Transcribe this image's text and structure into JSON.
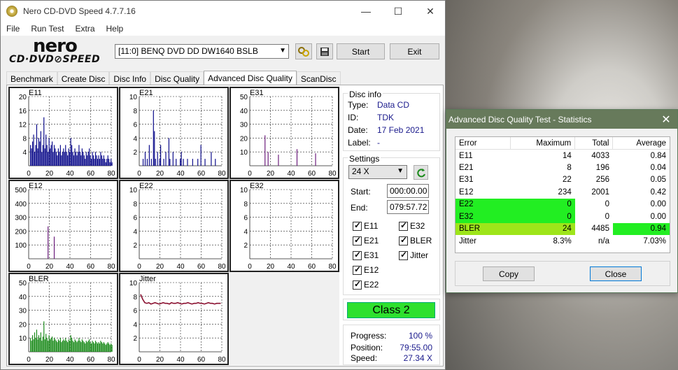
{
  "window": {
    "title": "Nero CD-DVD Speed 4.7.7.16",
    "minimize": "—",
    "maximize": "☐",
    "close": "✕"
  },
  "menu": [
    "File",
    "Run Test",
    "Extra",
    "Help"
  ],
  "logo": {
    "top": "nero",
    "bottom": "CD·DVD⊘SPEED"
  },
  "toolbar": {
    "drive": "[11:0]   BENQ DVD DD DW1640 BSLB",
    "start": "Start",
    "exit": "Exit"
  },
  "tabs": [
    "Benchmark",
    "Create Disc",
    "Disc Info",
    "Disc Quality",
    "Advanced Disc Quality",
    "ScanDisc"
  ],
  "active_tab": "Advanced Disc Quality",
  "disc_info": {
    "title": "Disc info",
    "type_label": "Type:",
    "type": "Data CD",
    "id_label": "ID:",
    "id": "TDK",
    "date_label": "Date:",
    "date": "17 Feb 2021",
    "label_label": "Label:",
    "label": "-"
  },
  "settings": {
    "title": "Settings",
    "speed": "24 X",
    "start_label": "Start:",
    "start": "000:00.00",
    "end_label": "End:",
    "end": "079:57.72",
    "checks": [
      "E11",
      "E32",
      "E21",
      "BLER",
      "E31",
      "Jitter",
      "E12",
      "E22"
    ]
  },
  "class_label": "Class 2",
  "progress": {
    "progress_label": "Progress:",
    "progress": "100 %",
    "position_label": "Position:",
    "position": "79:55.00",
    "speed_label": "Speed:",
    "speed": "27.34 X"
  },
  "colors": {
    "graph_blue": "#0a0a8a",
    "graph_purple": "#6a1a7a",
    "graph_green": "#1a8a1a",
    "jitter_red": "#8a1030",
    "class_green": "#2ee02e"
  },
  "chart_data": [
    {
      "type": "bar",
      "title": "E11",
      "x": [
        0,
        20,
        40,
        60,
        80
      ],
      "ylim": [
        0,
        20
      ],
      "yticks": [
        4,
        8,
        12,
        16,
        20
      ],
      "xticks": [
        0,
        20,
        40,
        60,
        80
      ],
      "series": [
        {
          "values": [
            6,
            5,
            7,
            9,
            4,
            6,
            12,
            5,
            8,
            7,
            10,
            4,
            6,
            14,
            5,
            9,
            6,
            4,
            8,
            5,
            6,
            7,
            4,
            6,
            5,
            4,
            3,
            5,
            4,
            6,
            3,
            4,
            5,
            4,
            6,
            4,
            3,
            5,
            4,
            8,
            6,
            4,
            3,
            5,
            4,
            3,
            4,
            6,
            4,
            3,
            5,
            4,
            3,
            2,
            4,
            3,
            4,
            5,
            3,
            2,
            4,
            3,
            2,
            4,
            3,
            2,
            3,
            2,
            4,
            3,
            2,
            3,
            2,
            1,
            2,
            3,
            2,
            1,
            2,
            1
          ]
        }
      ]
    },
    {
      "type": "bar",
      "title": "E21",
      "x": [
        0,
        20,
        40,
        60,
        80
      ],
      "ylim": [
        0,
        10
      ],
      "yticks": [
        2,
        4,
        6,
        8,
        10
      ],
      "xticks": [
        0,
        20,
        40,
        60,
        80
      ],
      "series": [
        {
          "values": [
            0,
            0,
            1,
            0,
            2,
            0,
            1,
            0,
            3,
            0,
            1,
            0,
            8,
            5,
            1,
            0,
            2,
            0,
            1,
            3,
            0,
            0,
            1,
            0,
            2,
            0,
            0,
            4,
            1,
            0,
            0,
            2,
            0,
            0,
            1,
            0,
            0,
            0,
            1,
            2,
            0,
            1,
            0,
            0,
            0,
            1,
            0,
            0,
            0,
            0,
            1,
            0,
            0,
            0,
            0,
            1,
            0,
            0,
            3,
            0,
            0,
            0,
            1,
            0,
            0,
            0,
            0,
            0,
            2,
            0,
            0,
            0,
            1,
            0,
            0,
            0,
            0,
            0,
            0,
            0
          ]
        }
      ]
    },
    {
      "type": "bar",
      "title": "E31",
      "x": [
        0,
        20,
        40,
        60,
        80
      ],
      "ylim": [
        0,
        50
      ],
      "yticks": [
        10,
        20,
        30,
        40,
        50
      ],
      "xticks": [
        0,
        20,
        40,
        60,
        80
      ],
      "series": [
        {
          "values": [
            0,
            0,
            0,
            0,
            0,
            0,
            0,
            0,
            0,
            0,
            0,
            0,
            0,
            22,
            0,
            0,
            10,
            0,
            0,
            0,
            0,
            0,
            0,
            0,
            0,
            0,
            8,
            0,
            0,
            0,
            0,
            0,
            0,
            0,
            0,
            0,
            0,
            0,
            0,
            0,
            0,
            0,
            0,
            0,
            12,
            0,
            0,
            0,
            0,
            0,
            0,
            0,
            0,
            0,
            0,
            0,
            0,
            0,
            0,
            0,
            0,
            0,
            9,
            0,
            0,
            0,
            0,
            0,
            0,
            0,
            0,
            0,
            0,
            0,
            0,
            0,
            0,
            0,
            0,
            0
          ]
        }
      ]
    },
    {
      "type": "bar",
      "title": "E12",
      "x": [
        0,
        20,
        40,
        60,
        80
      ],
      "ylim": [
        0,
        500
      ],
      "yticks": [
        100,
        200,
        300,
        400,
        500
      ],
      "xticks": [
        0,
        20,
        40,
        60,
        80
      ],
      "series": [
        {
          "values": [
            0,
            0,
            0,
            0,
            0,
            0,
            0,
            0,
            0,
            0,
            0,
            0,
            0,
            0,
            0,
            0,
            0,
            234,
            0,
            0,
            0,
            0,
            0,
            160,
            0,
            0,
            0,
            0,
            0,
            0,
            0,
            0,
            0,
            0,
            0,
            0,
            0,
            0,
            0,
            0,
            0,
            0,
            0,
            0,
            0,
            0,
            0,
            0,
            0,
            0,
            0,
            0,
            0,
            0,
            0,
            0,
            0,
            0,
            0,
            0,
            0,
            0,
            0,
            0,
            0,
            0,
            0,
            0,
            0,
            0,
            0,
            0,
            0,
            0,
            0,
            0,
            0,
            0,
            0,
            0
          ]
        }
      ]
    },
    {
      "type": "bar",
      "title": "E22",
      "x": [
        0,
        20,
        40,
        60,
        80
      ],
      "ylim": [
        0,
        10
      ],
      "yticks": [
        2,
        4,
        6,
        8,
        10
      ],
      "xticks": [
        0,
        20,
        40,
        60,
        80
      ],
      "series": [
        {
          "values": []
        }
      ]
    },
    {
      "type": "bar",
      "title": "E32",
      "x": [
        0,
        20,
        40,
        60,
        80
      ],
      "ylim": [
        0,
        10
      ],
      "yticks": [
        2,
        4,
        6,
        8,
        10
      ],
      "xticks": [
        0,
        20,
        40,
        60,
        80
      ],
      "series": [
        {
          "values": []
        }
      ]
    },
    {
      "type": "bar",
      "title": "BLER",
      "x": [
        0,
        20,
        40,
        60,
        80
      ],
      "ylim": [
        0,
        50
      ],
      "yticks": [
        10,
        20,
        30,
        40,
        50
      ],
      "xticks": [
        0,
        20,
        40,
        60,
        80
      ],
      "series": [
        {
          "values": [
            10,
            8,
            12,
            9,
            14,
            10,
            16,
            9,
            12,
            10,
            14,
            8,
            11,
            22,
            9,
            13,
            10,
            8,
            12,
            9,
            10,
            11,
            8,
            10,
            9,
            8,
            7,
            9,
            8,
            10,
            7,
            8,
            9,
            8,
            10,
            8,
            7,
            9,
            8,
            12,
            10,
            8,
            7,
            9,
            8,
            7,
            8,
            10,
            8,
            7,
            9,
            8,
            7,
            6,
            8,
            7,
            8,
            9,
            7,
            6,
            8,
            7,
            6,
            8,
            7,
            6,
            7,
            6,
            8,
            7,
            6,
            7,
            6,
            5,
            6,
            7,
            6,
            5,
            6,
            5
          ]
        }
      ]
    },
    {
      "type": "line",
      "title": "Jitter",
      "x": [
        0,
        20,
        40,
        60,
        80
      ],
      "ylim": [
        0,
        10
      ],
      "yticks": [
        2,
        4,
        6,
        8,
        10
      ],
      "xticks": [
        0,
        20,
        40,
        60,
        80
      ],
      "series": [
        {
          "values": [
            8.3,
            7.6,
            7.1,
            7.0,
            7.1,
            6.9,
            7.0,
            7.1,
            7.0,
            6.9,
            7.0,
            7.1,
            7.0,
            7.0,
            6.9,
            7.1,
            7.0,
            7.0,
            7.1,
            7.0,
            6.9,
            7.0,
            7.0,
            7.1,
            7.0,
            6.9,
            7.0,
            7.0,
            7.1,
            7.0,
            7.0,
            6.9,
            7.0,
            7.1,
            7.0,
            7.0,
            6.9,
            7.0,
            7.0,
            7.0
          ]
        }
      ]
    }
  ],
  "stats_dialog": {
    "title": "Advanced Disc Quality Test - Statistics",
    "close_x": "✕",
    "headers": [
      "Error",
      "Maximum",
      "Total",
      "Average"
    ],
    "rows": [
      [
        "E11",
        "14",
        "4033",
        "0.84"
      ],
      [
        "E21",
        "8",
        "196",
        "0.04"
      ],
      [
        "E31",
        "22",
        "256",
        "0.05"
      ],
      [
        "E12",
        "234",
        "2001",
        "0.42"
      ],
      [
        "E22",
        "0",
        "0",
        "0.00"
      ],
      [
        "E32",
        "0",
        "0",
        "0.00"
      ],
      [
        "BLER",
        "24",
        "4485",
        "0.94"
      ],
      [
        "Jitter",
        "8.3%",
        "n/a",
        "7.03%"
      ]
    ],
    "copy": "Copy",
    "close": "Close"
  }
}
